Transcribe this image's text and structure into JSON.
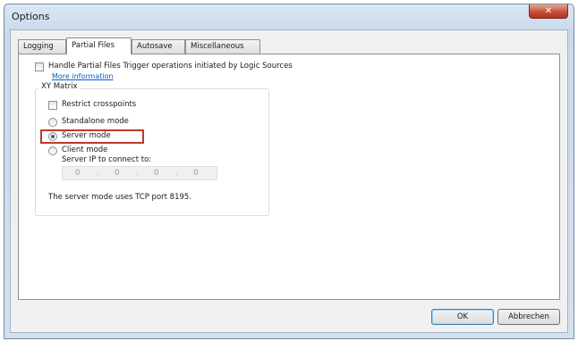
{
  "window": {
    "title": "Options",
    "close_glyph": "✕"
  },
  "tabs": [
    {
      "label": "Logging",
      "active": false
    },
    {
      "label": "Partial Files",
      "active": true
    },
    {
      "label": "Autosave",
      "active": false
    },
    {
      "label": "Miscellaneous",
      "active": false
    }
  ],
  "partial_files": {
    "handle_checkbox_label": "Handle Partial Files Trigger operations initiated by Logic Sources",
    "handle_checked": false,
    "more_info_link": "More information"
  },
  "xy_matrix": {
    "group_title": "XY Matrix",
    "restrict_label": "Restrict crosspoints",
    "restrict_checked": false,
    "modes": [
      {
        "label": "Standalone mode",
        "selected": false
      },
      {
        "label": "Server mode",
        "selected": true
      },
      {
        "label": "Client mode",
        "selected": false
      }
    ],
    "server_ip_label": "Server IP to connect to:",
    "ip_segments": [
      "0",
      "0",
      "0",
      "0"
    ],
    "ip_separator": ".",
    "server_note": "The server mode uses TCP port 8195."
  },
  "buttons": {
    "ok": "OK",
    "cancel": "Abbrechen"
  },
  "colors": {
    "highlight_border": "#c0392b",
    "link": "#0a5fc4"
  }
}
